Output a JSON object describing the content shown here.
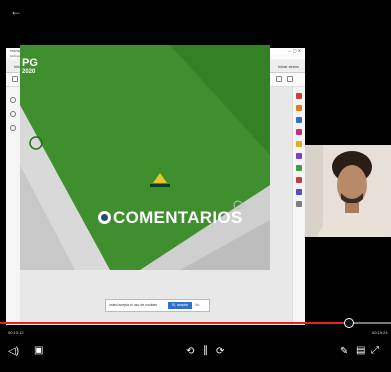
{
  "top_bar": {
    "back_icon": "back-arrow-icon"
  },
  "app": {
    "window_title": "PRESENTACIÓN FINAL.pdf - Adobe Acrobat Reader DC",
    "menu": [
      "Archivo",
      "Edición",
      "Ver",
      "Firmar",
      "Ventana",
      "Ayuda"
    ],
    "tabs": [
      "Inicio",
      "Herramientas",
      "Carta de Respuest...",
      "PRESENTACIÓN FI..."
    ],
    "signin_label": "Iniciar sesión",
    "page_counter": "1 / 6",
    "zoom": "53%"
  },
  "slide": {
    "logo": "PG",
    "year": "2020",
    "title": "COMENTARIOS"
  },
  "cookie_bar": {
    "text": "usted acepta el uso de cookies",
    "accept": "Sí, aceptar",
    "decline": "No"
  },
  "player": {
    "elapsed": "00:13:12",
    "total": "00:15:24",
    "progress": 0.89
  },
  "colors": {
    "slide_green": "#3f8f2e",
    "seek": "#e62117"
  }
}
